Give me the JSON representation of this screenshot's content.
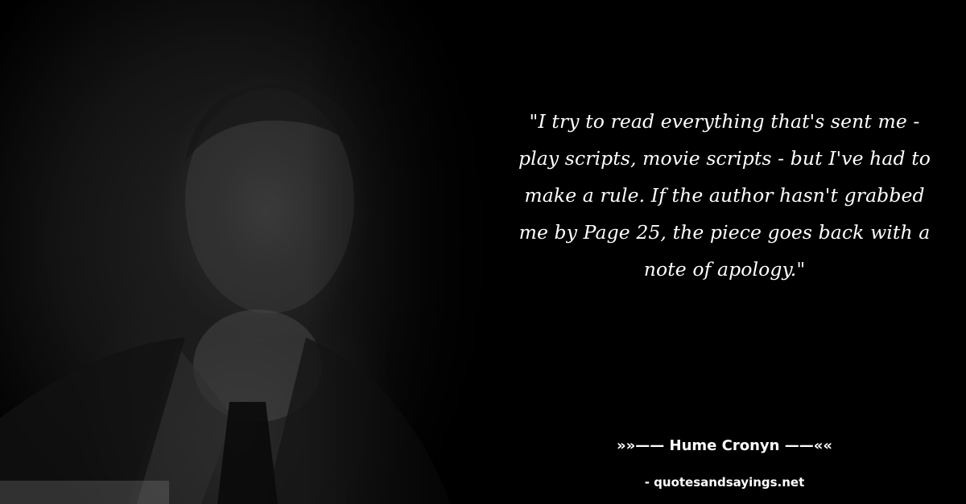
{
  "quote": {
    "text": "\"I try to read everything that's sent me - play scripts, movie scripts - but I've had to make a rule. If the author hasn't grabbed me by Page 25, the piece goes back with a note of apology.\""
  },
  "author": {
    "label": "»»—— Hume Cronyn ——««"
  },
  "source": {
    "label": "- quotesandsayings.net"
  },
  "colors": {
    "background": "#000000",
    "text": "#ffffff"
  }
}
